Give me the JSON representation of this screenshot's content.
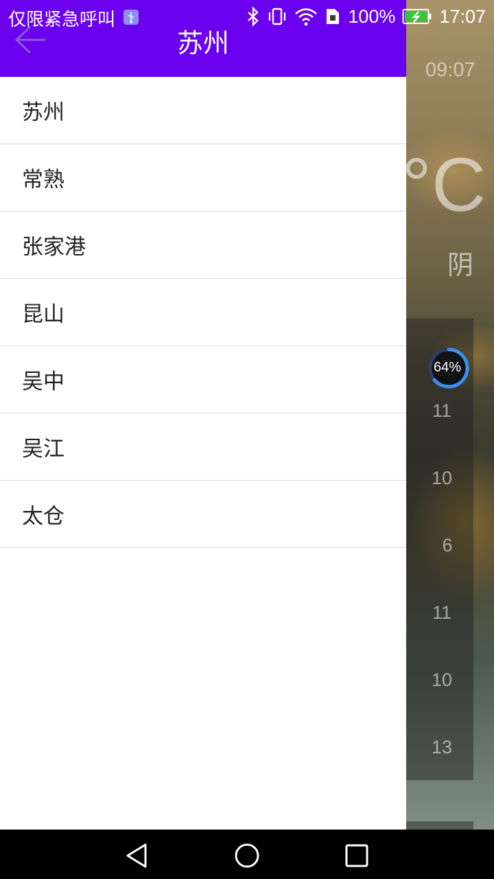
{
  "status_bar": {
    "carrier_text": "仅限紧急呼叫",
    "battery_percent": "100%",
    "time": "17:07",
    "icons": [
      "usb-icon",
      "bluetooth-icon",
      "vibrate-icon",
      "wifi-icon",
      "sim-icon",
      "battery-charging-icon"
    ]
  },
  "drawer": {
    "title": "苏州",
    "back_icon": "arrow-left-icon",
    "accent_color": "#6a00ee",
    "cities": [
      "苏州",
      "常熟",
      "张家港",
      "昆山",
      "吴中",
      "吴江",
      "太仓"
    ]
  },
  "background_app": {
    "time": "09:07",
    "temperature_unit": "°C",
    "condition": "阴",
    "progress_label": "64%",
    "progress_value": 0.64,
    "temps": [
      "11",
      "10",
      "6",
      "11",
      "10",
      "13"
    ]
  },
  "nav_bar": {
    "icons": [
      "back-triangle-icon",
      "home-circle-icon",
      "recents-square-icon"
    ]
  }
}
